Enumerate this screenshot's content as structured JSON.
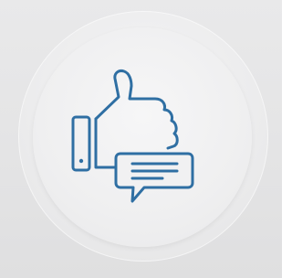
{
  "icon": {
    "name": "thumbs-up-feedback-icon",
    "color": "#2f6fa3"
  },
  "background": {
    "page": "#e6e6e7",
    "badge": "#efeff0"
  }
}
